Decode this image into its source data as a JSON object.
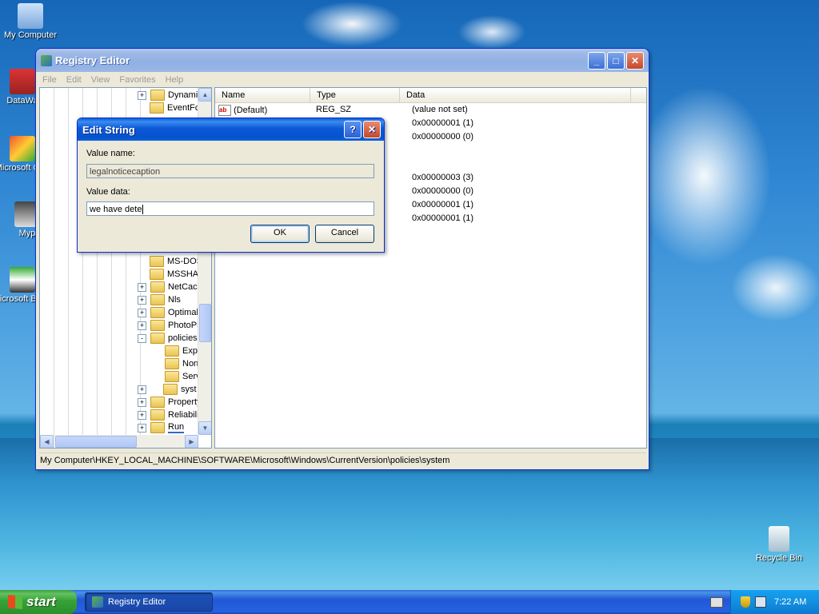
{
  "desktop": {
    "icons": [
      {
        "label": "My Computer",
        "icon": "my-computer-icon"
      },
      {
        "label": "DataWa",
        "icon": "shortcut-icon"
      },
      {
        "label": "Microsoft C++",
        "icon": "vcpp-icon"
      },
      {
        "label": "Myp",
        "icon": "shortcut-icon"
      },
      {
        "label": "Microsoft Basic",
        "icon": "vb-icon"
      },
      {
        "label": "Recycle Bin",
        "icon": "recycle-bin-icon"
      }
    ]
  },
  "window": {
    "title": "Registry Editor",
    "menu": [
      "File",
      "Edit",
      "View",
      "Favorites",
      "Help"
    ],
    "tree": [
      {
        "label": "Dynamic",
        "expander": "+"
      },
      {
        "label": "EventFc",
        "expander": ""
      },
      {
        "label": "MS-DOS",
        "expander": ""
      },
      {
        "label": "MSSHA",
        "expander": ""
      },
      {
        "label": "NetCach",
        "expander": "+"
      },
      {
        "label": "Nls",
        "expander": "+"
      },
      {
        "label": "Optimall",
        "expander": "+"
      },
      {
        "label": "PhotoPr",
        "expander": "+"
      },
      {
        "label": "policies",
        "expander": "-"
      },
      {
        "label": "Expl",
        "expander": ""
      },
      {
        "label": "Non",
        "expander": ""
      },
      {
        "label": "Serv",
        "expander": ""
      },
      {
        "label": "syst",
        "expander": "+"
      },
      {
        "label": "Property",
        "expander": "+"
      },
      {
        "label": "Reliabilit",
        "expander": "+"
      },
      {
        "label": "Run",
        "expander": "+"
      }
    ],
    "columns": {
      "name": "Name",
      "type": "Type",
      "data": "Data"
    },
    "rows": [
      {
        "name": "(Default)",
        "type": "REG_SZ",
        "data": "(value not set)"
      },
      {
        "name": "",
        "type": "",
        "data": "0x00000001 (1)"
      },
      {
        "name": "",
        "type": "",
        "data": "0x00000000 (0)"
      },
      {
        "name": "",
        "type": "",
        "data": "0x00000003 (3)"
      },
      {
        "name": "",
        "type": "",
        "data": "0x00000000 (0)"
      },
      {
        "name": "",
        "type": "",
        "data": "0x00000001 (1)"
      },
      {
        "name": "",
        "type": "",
        "data": "0x00000001 (1)"
      }
    ],
    "status": "My Computer\\HKEY_LOCAL_MACHINE\\SOFTWARE\\Microsoft\\Windows\\CurrentVersion\\policies\\system"
  },
  "dialog": {
    "title": "Edit String",
    "value_name_label": "Value name:",
    "value_name": "legalnoticecaption",
    "value_data_label": "Value data:",
    "value_data": "we have dete",
    "ok": "OK",
    "cancel": "Cancel"
  },
  "taskbar": {
    "start": "start",
    "task": "Registry Editor",
    "clock": "7:22 AM"
  }
}
